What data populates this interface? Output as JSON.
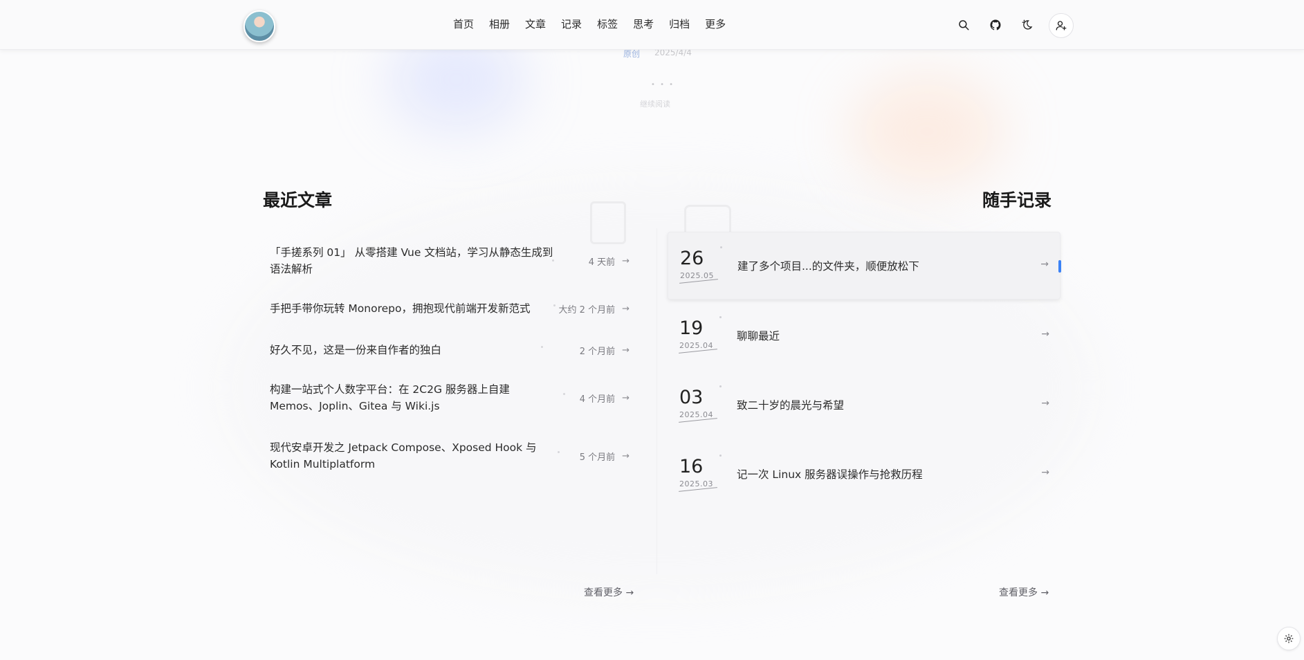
{
  "hero": {
    "tag": "原创",
    "date": "2025/4/4",
    "continue": "继续阅读",
    "dots": "• • •"
  },
  "nav": {
    "items": [
      "首页",
      "相册",
      "文章",
      "记录",
      "标签",
      "思考",
      "归档",
      "更多"
    ]
  },
  "icons": {
    "search": "search-icon",
    "github": "github-icon",
    "theme": "theme-toggle-icon",
    "user": "user-plus-icon",
    "settings": "gear-icon"
  },
  "recent_articles": {
    "title": "最近文章",
    "items": [
      {
        "title": "「手搓系列 01」 从零搭建 Vue 文档站，学习从静态生成到语法解析",
        "time": "4 天前"
      },
      {
        "title": "手把手带你玩转 Monorepo，拥抱现代前端开发新范式",
        "time": "大约 2 个月前"
      },
      {
        "title": "好久不见，这是一份来自作者的独白",
        "time": "2 个月前"
      },
      {
        "title": "构建一站式个人数字平台：在 2C2G 服务器上自建 Memos、Joplin、Gitea 与 Wiki.js",
        "time": "4 个月前"
      },
      {
        "title": "现代安卓开发之 Jetpack Compose、Xposed Hook 与 Kotlin Multiplatform",
        "time": "5 个月前"
      }
    ],
    "see_more": "查看更多"
  },
  "notes": {
    "title": "随手记录",
    "items": [
      {
        "day": "26",
        "ym": "2025.05",
        "title": "建了多个项目...的文件夹，顺便放松下"
      },
      {
        "day": "19",
        "ym": "2025.04",
        "title": "聊聊最近"
      },
      {
        "day": "03",
        "ym": "2025.04",
        "title": "致二十岁的晨光与希望"
      },
      {
        "day": "16",
        "ym": "2025.03",
        "title": "记一次 Linux 服务器误操作与抢救历程"
      }
    ],
    "see_more": "查看更多"
  },
  "arrow_glyph": "→",
  "colors": {
    "accent": "#3b82f6",
    "text": "#2b2b2b",
    "muted": "#7a7a80"
  }
}
